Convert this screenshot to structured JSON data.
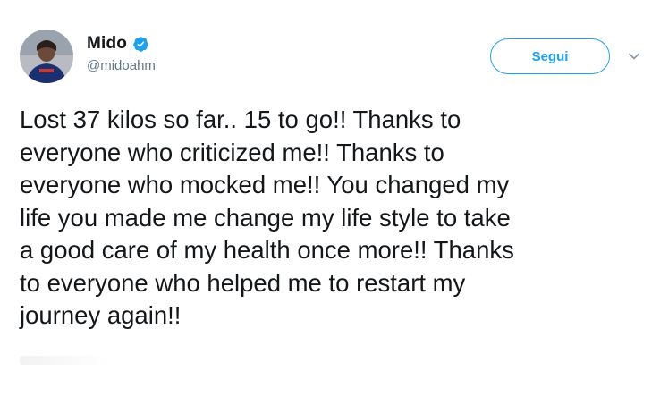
{
  "user": {
    "display_name": "Mido",
    "handle": "@midoahm",
    "verified_icon": "verified-badge-icon",
    "verified_color": "#1da1f2"
  },
  "actions": {
    "follow_label": "Segui",
    "menu_icon": "chevron-down-icon",
    "accent_color": "#1da1f2"
  },
  "tweet": {
    "lines": [
      "Lost 37 kilos so far.. 15 to go!! Thanks to",
      "everyone who criticized me!! Thanks to",
      "everyone who mocked me!! You changed my",
      "life you made me change my life style to take",
      "a good care of my health once more!! Thanks",
      "to everyone who helped me to restart my",
      "journey again!!"
    ]
  }
}
